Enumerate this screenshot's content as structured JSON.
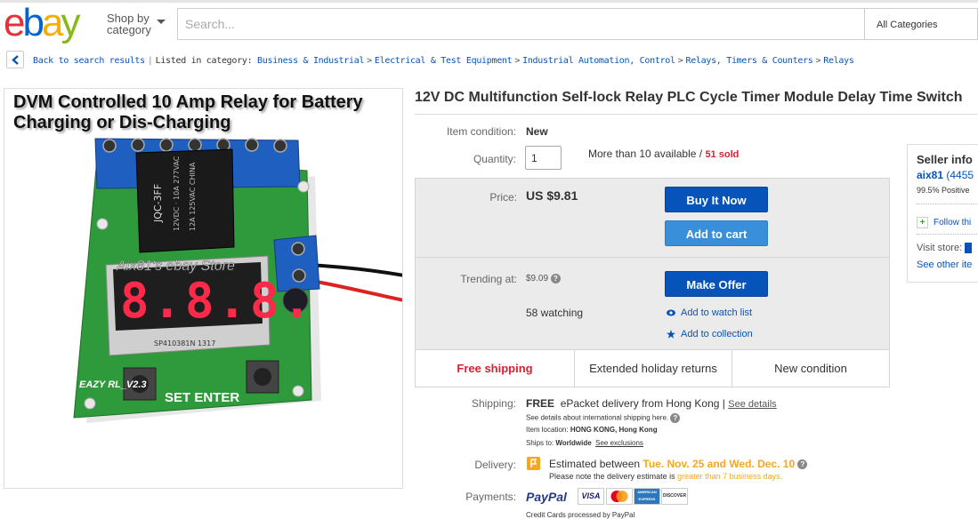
{
  "header": {
    "logo_letters": [
      {
        "ch": "e",
        "color": "#e53238"
      },
      {
        "ch": "b",
        "color": "#0064d2"
      },
      {
        "ch": "a",
        "color": "#f5af02"
      },
      {
        "ch": "y",
        "color": "#86b817"
      }
    ],
    "shop_by_line1": "Shop by",
    "shop_by_line2": "category",
    "search_placeholder": "Search...",
    "category_select": "All Categories"
  },
  "breadcrumb": {
    "back": "Back to search results",
    "listed": "Listed in category:",
    "items": [
      "Business & Industrial",
      "Electrical & Test Equipment",
      "Industrial Automation, Control",
      "Relays, Timers & Counters",
      "Relays"
    ]
  },
  "image": {
    "caption": "DVM Controlled 10 Amp Relay for Battery Charging or Dis-Charging",
    "watermark": "Aix81's ebay Store",
    "display": "8.8.8.",
    "relay_text": "JQC-3FF",
    "set_enter": "SET ENTER",
    "board_label": "EAZY RL_V2.3",
    "chip_label": "SP410381N 1317"
  },
  "item": {
    "title": "12V DC Multifunction Self-lock Relay PLC Cycle Timer Module Delay Time Switch",
    "condition_label": "Item condition:",
    "condition_value": "New",
    "quantity_label": "Quantity:",
    "quantity_value": "1",
    "available": "More than 10 available",
    "sold_sep": " / ",
    "sold": "51 sold",
    "price_label": "Price:",
    "price": "US $9.81",
    "buy_now": "Buy It Now",
    "add_cart": "Add to cart",
    "trending_label": "Trending at:",
    "trending_value": "$9.09",
    "make_offer": "Make Offer",
    "watching": "58 watching",
    "watch_list": "Add to watch list",
    "collection": "Add to collection",
    "free_shipping": "Free shipping",
    "holiday_returns": "Extended holiday returns",
    "new_condition": "New condition"
  },
  "shipping": {
    "label": "Shipping:",
    "free": "FREE",
    "method": "ePacket delivery from Hong Kong |",
    "see_details": "See details",
    "intl": "See details about international shipping here.",
    "location_label": "Item location:",
    "location": "HONG KONG, Hong Kong",
    "ships_label": "Ships to:",
    "ships": "Worldwide",
    "exclusions": "See exclusions"
  },
  "delivery": {
    "label": "Delivery:",
    "estimated": "Estimated between",
    "dates": "Tue. Nov. 25 and Wed. Dec. 10",
    "note_prefix": "Please note the delivery estimate is",
    "note_highlight": "greater than 7 business days."
  },
  "payments": {
    "label": "Payments:",
    "paypal": "PayPal",
    "visa": "VISA",
    "amex": "AMERICAN EXPRESS",
    "discover": "DISCOVER",
    "credit_note": "Credit Cards processed by PayPal"
  },
  "seller": {
    "heading": "Seller info",
    "name": "aix81",
    "feedback": "(4455",
    "positive": "99.5% Positive",
    "follow": "Follow thi",
    "visit": "Visit store:",
    "other": "See other ite"
  },
  "colors": {
    "link": "#0654ba",
    "sold": "#dd1e31",
    "date_orange": "#f5a623"
  }
}
